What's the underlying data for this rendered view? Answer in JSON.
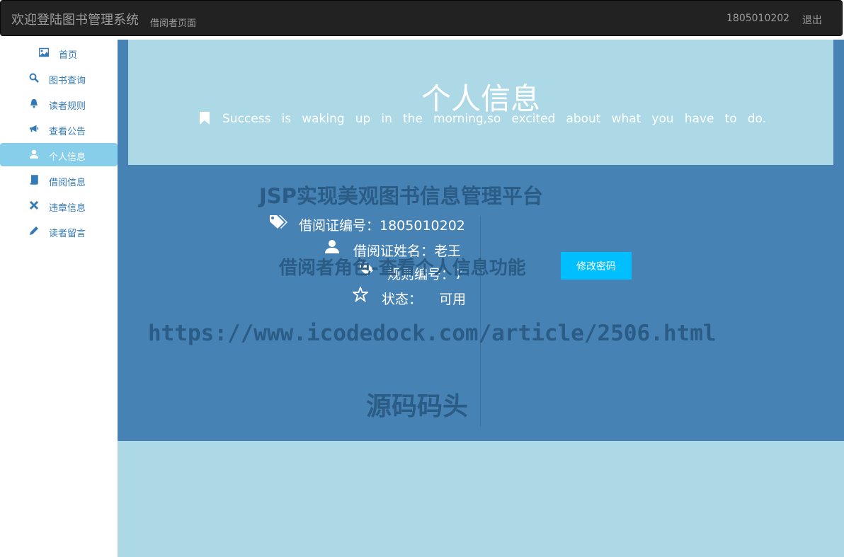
{
  "navbar": {
    "brand": "欢迎登陆图书管理系统",
    "subtitle": "借阅者页面",
    "user_id": "1805010202",
    "logout": "退出"
  },
  "sidebar": {
    "items": [
      {
        "label": "首页",
        "icon": "picture-icon"
      },
      {
        "label": "图书查询",
        "icon": "search-icon"
      },
      {
        "label": "读者规则",
        "icon": "bell-icon"
      },
      {
        "label": "查看公告",
        "icon": "bullhorn-icon"
      },
      {
        "label": "个人信息",
        "icon": "user-icon",
        "active": true
      },
      {
        "label": "借阅信息",
        "icon": "book-icon"
      },
      {
        "label": "违章信息",
        "icon": "remove-icon"
      },
      {
        "label": "读者留言",
        "icon": "pencil-icon"
      }
    ]
  },
  "jumbotron": {
    "title": "个人信息",
    "quote": "Success is waking up in the morning,so excited about what you have to do."
  },
  "profile": {
    "card_no": "借阅证编号：1805010202",
    "name": "借阅证姓名：老王",
    "rule_no": "规则编号：7",
    "status": "状态：    可用"
  },
  "actions": {
    "change_password": "修改密码"
  },
  "watermark": {
    "line1": "JSP实现美观图书信息管理平台",
    "line2": "借阅者角色-查看个人信息功能",
    "line3": "https://www.icodedock.com/article/2506.html",
    "line4": "源码码头"
  },
  "colors": {
    "navbar_bg": "#222222",
    "panel_blue": "#4682b4",
    "light_blue": "#add8e6",
    "active_item": "#87ceeb",
    "button": "#00bfff",
    "link": "#337ab7"
  }
}
